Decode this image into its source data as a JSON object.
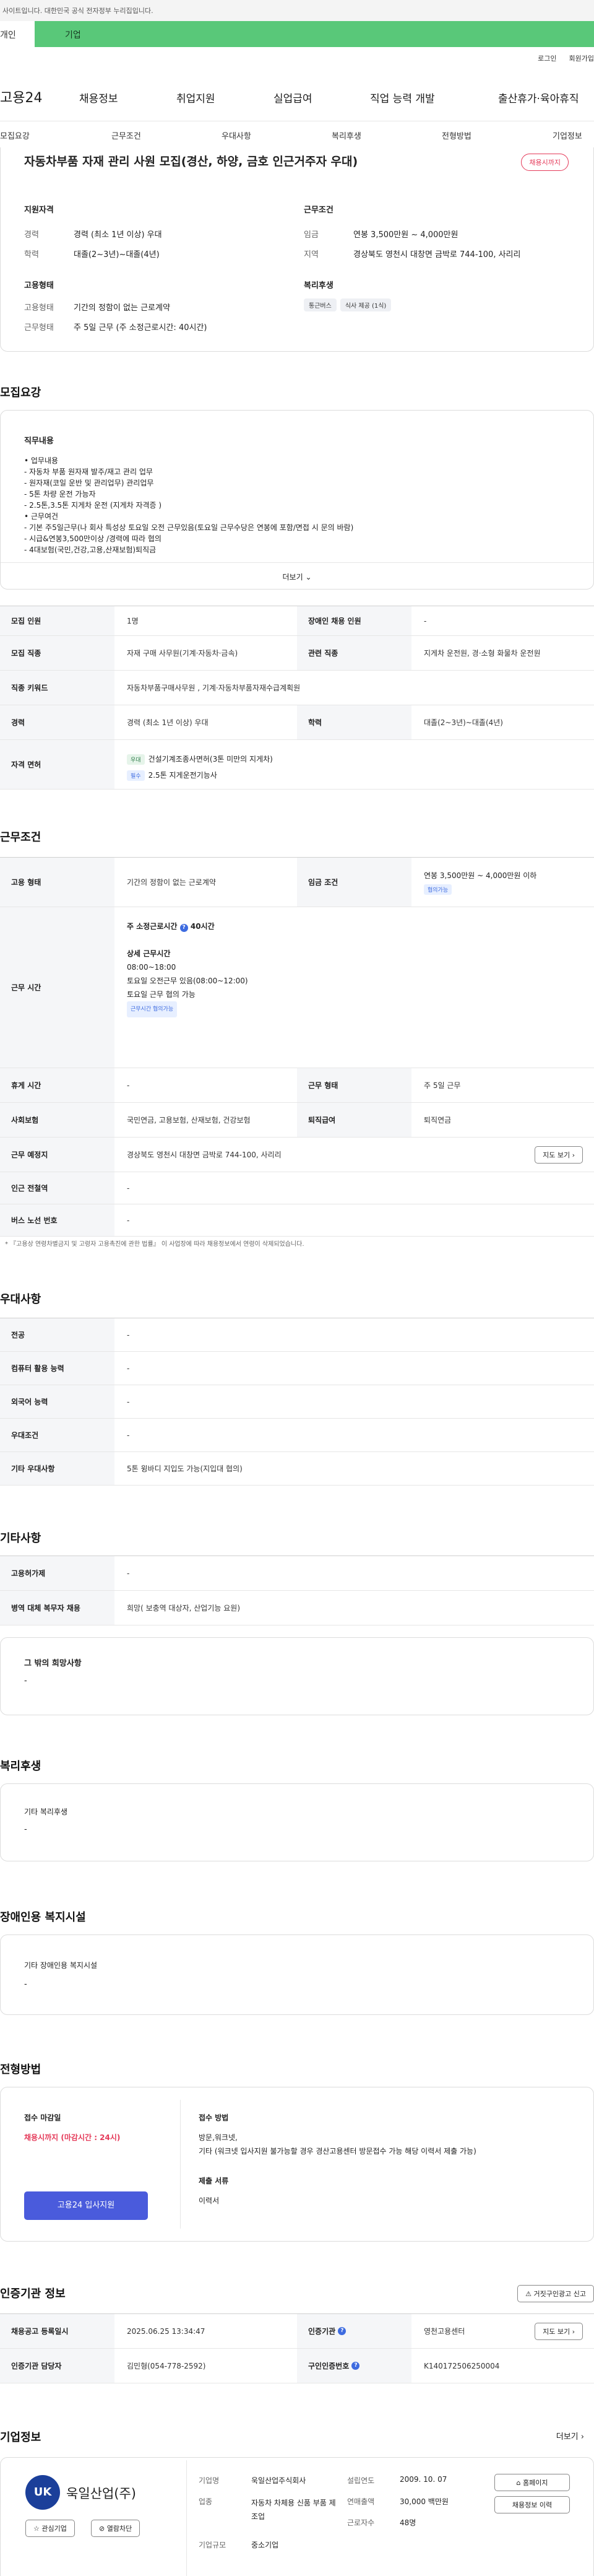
{
  "gov_notice": "사이트입니다. 대한민국 공식 전자정부 누리집입니다.",
  "top_tabs": {
    "personal": "개인",
    "company": "기업"
  },
  "util": {
    "login": "로그인",
    "join": "회원가입"
  },
  "gnb": {
    "logo": "고용24",
    "menu": [
      "채용정보",
      "취업지원",
      "실업급여",
      "직업 능력 개발",
      "출산휴가·육아휴직"
    ]
  },
  "subnav": [
    "모집요강",
    "근무조건",
    "우대사항",
    "복리후생",
    "전형방법",
    "기업정보"
  ],
  "job": {
    "title": "자동차부품 자재 관리 사원 모집(경산, 하양, 금호 인근거주자 우대)",
    "badge": "채용시까지",
    "qual_title": "지원자격",
    "career_lbl": "경력",
    "career_val": "경력 (최소 1년 이상) 우대",
    "edu_lbl": "학력",
    "edu_val": "대졸(2~3년)~대졸(4년)",
    "cond_title": "근무조건",
    "pay_lbl": "임금",
    "pay_val": "연봉 3,500만원 ~ 4,000만원",
    "loc_lbl": "지역",
    "loc_val": "경상북도 영천시 대창면 금박로 744-100, 사리리",
    "emp_title": "고용형태",
    "type_lbl": "고용형태",
    "type_val": "기간의 정함이 없는 근로계약",
    "form_lbl": "근무형태",
    "form_val": "주 5일 근무 (주 소정근로시간: 40시간)",
    "welfare_title": "복리후생",
    "tags": [
      "통근버스",
      "식사 제공 (1식)"
    ]
  },
  "recruit": {
    "heading": "모집요강",
    "duty_title": "직무내용",
    "lines": [
      "• 업무내용",
      "- 자동차 부품 원자재 발주/재고 관리 업무",
      "- 원자재(코일 운반 및 관리업무) 관리업무",
      "- 5톤 차량 운전 가능자",
      "- 2.5톤,3.5톤  지게차 운전 (지게차 자격증 )",
      "• 근무여건",
      "- 기본 주5일근무(나 회사 특성상 토요일 오전 근무있음(토요일 근무수당은 연봉에 포함/면접 시 문의 바람)",
      "- 시급&연봉3,500만이상 /경력에 따라 협의",
      "- 4대보험(국민,건강,고용,산재보험)퇴직금"
    ],
    "more": "더보기"
  },
  "recruit_table": {
    "r1": [
      "모집 인원",
      "1명",
      "장애인 채용 인원",
      "-"
    ],
    "r2": [
      "모집 직종",
      "자재 구매 사무원(기계·자동차·금속)",
      "관련 직종",
      "지게차 운전원, 경·소형 화물차 운전원"
    ],
    "r3": [
      "직종 키워드",
      "자동차부품구매사무원 , 기계·자동차부품자재수급계획원"
    ],
    "r4": [
      "경력",
      "경력 (최소 1년 이상) 우대",
      "학력",
      "대졸(2~3년)~대졸(4년)"
    ],
    "license_th": "자격 면허",
    "lic1_chip": "우대",
    "lic1": "건설기계조종사면허(3톤 미만의 지게차)",
    "lic2_chip": "필수",
    "lic2": "2.5톤 지게운전기능사"
  },
  "work": {
    "heading": "근무조건",
    "emp_th": "고용 형태",
    "emp_td": "기간의 정함이 없는 근로계약",
    "pay_th": "임금 조건",
    "pay_td": "연봉 3,500만원 ~ 4,000만원 이하",
    "pay_chip": "협의가능",
    "time_th": "근무 시간",
    "weekly": "주 소정근로시간",
    "weekly_val": "40시간",
    "detail_title": "상세 근무시간",
    "d1": "08:00~18:00",
    "d2": "토요일 오전근무 있음(08:00~12:00)",
    "d3": "토요일 근무 협의 가능",
    "time_chip": "근무시간 협의가능",
    "rest_th": "휴게 시간",
    "rest_td": "-",
    "form_th": "근무 형태",
    "form_td": "주 5일 근무",
    "ins_th": "사회보험",
    "ins_td": "국민연금, 고용보험, 산재보험, 건강보험",
    "ret_th": "퇴직급여",
    "ret_td": "퇴직연금",
    "addr_th": "근무 예정지",
    "addr_td": "경상북도 영천시 대창면 금박로 744-100, 사리리",
    "map": "지도 보기",
    "sub_th": "인근 전철역",
    "sub_td": "-",
    "bus_th": "버스 노선 번호",
    "bus_td": "-",
    "note": "* 『고용상 연령차별금지 및 고령자 고용촉진에 관한 법률』 이 사업장에 따라 채용정보에서 연령이 삭제되었습니다."
  },
  "pref": {
    "heading": "우대사항",
    "rows": [
      [
        "전공",
        "-"
      ],
      [
        "컴퓨터 활용 능력",
        "-"
      ],
      [
        "외국어 능력",
        "-"
      ],
      [
        "우대조건",
        "-"
      ],
      [
        "기타 우대사항",
        "5톤 윙바디 지입도 가능(지입대 협의)"
      ]
    ]
  },
  "etc": {
    "heading": "기타사항",
    "rows": [
      [
        "고용허가제",
        "-"
      ],
      [
        "병역 대체 복무자 채용",
        "희망( 보충역 대상자, 산업기능 요원)"
      ]
    ],
    "hope_title": "그 밖의 희망사항",
    "hope_val": "-"
  },
  "welfare": {
    "heading": "복리후생",
    "title": "기타 복리후생",
    "val": "-"
  },
  "disab": {
    "heading": "장애인용 복지시설",
    "title": "기타 장애인용 복지시설",
    "val": "-"
  },
  "process": {
    "heading": "전형방법",
    "deadline_title": "접수 마감일",
    "deadline_val": "채용시까지 (마감시간 : 24시)",
    "apply_btn": "고용24 입사지원",
    "method_title": "접수 방법",
    "method_val": "방문,워크넷,",
    "method_val2": "기타 (워크넷 입사지원 불가능할 경우 경산고용센터 방문접수 가능 해당 이력서 제출 가능)",
    "docs_title": "제출 서류",
    "docs_val": "이력서"
  },
  "cert": {
    "heading": "인증기관 정보",
    "report_btn": "거짓구인광고 신고",
    "reg_th": "채용공고 등록일시",
    "reg_td": "2025.06.25 13:34:47",
    "org_th": "인증기관",
    "org_td": "영천고용센터",
    "map": "지도 보기",
    "mgr_th": "인증기관 담당자",
    "mgr_td": "김민형(054-778-2592)",
    "id_th": "구인인증번호",
    "id_td": "K140172506250004"
  },
  "company": {
    "heading": "기업정보",
    "more": "더보기",
    "logo_text": "UK",
    "name": "욱일산업(주)",
    "fav": "관심기업",
    "block": "열람차단",
    "type_lbl": "기업명",
    "type_val": "욱일산업주식회사",
    "ind_lbl": "업종",
    "ind_val": "자동차 차체용 신품 부품 제조업",
    "scale_lbl": "기업규모",
    "scale_val": "중소기업",
    "est_lbl": "설립연도",
    "est_val": "2009. 10. 07",
    "sales_lbl": "연매출액",
    "sales_val": "30,000 백만원",
    "emp_lbl": "근로자수",
    "emp_val": "48명",
    "home_btn": "홈페이지",
    "jobs_btn": "채용정보 이력"
  }
}
